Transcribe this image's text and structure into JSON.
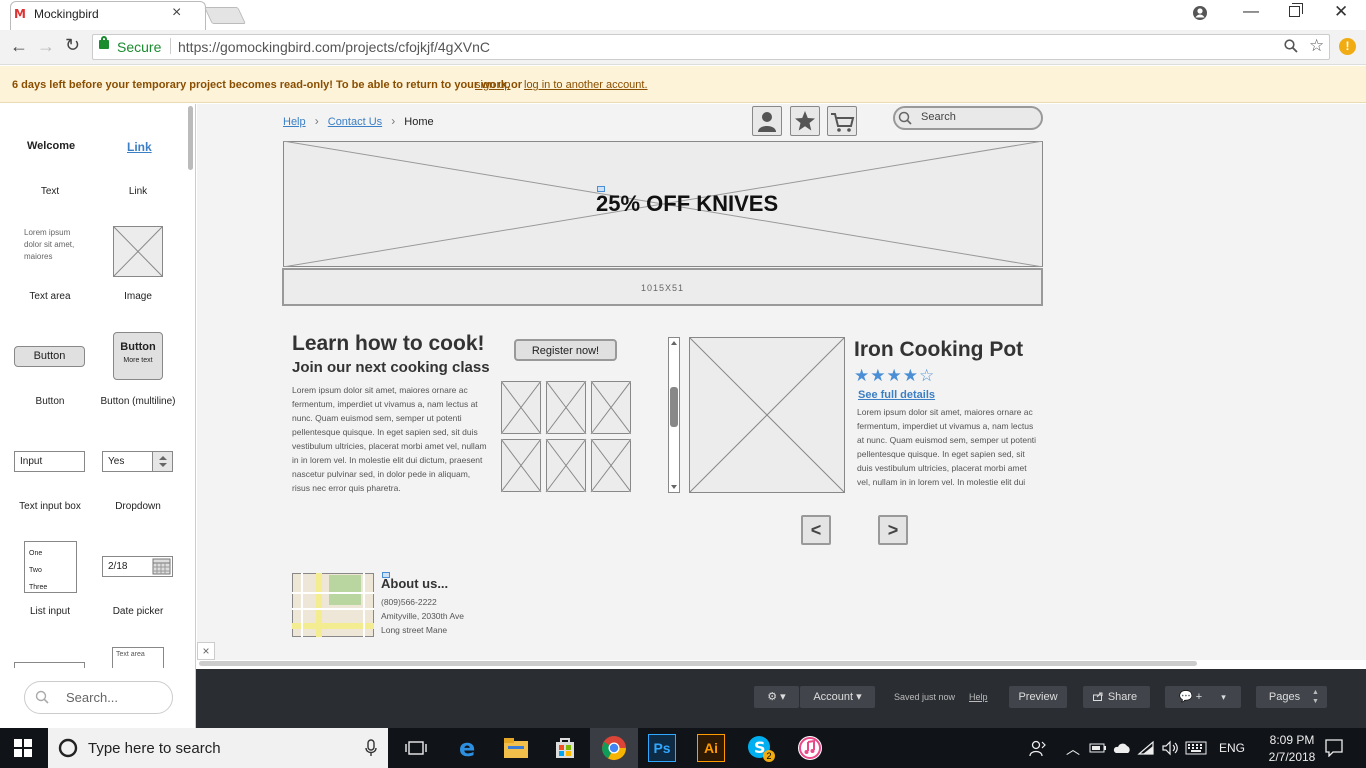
{
  "browser": {
    "tab_title": "Mockingbird",
    "tab_favicon": "M",
    "tab_close": "×",
    "secure_label": "Secure",
    "url": "https://gomockingbird.com/projects/cfojkjf/4gXVnC",
    "ext_badge": "!"
  },
  "banner": {
    "message": "6 days left before your temporary project becomes read-only! To be able to return to your work,",
    "signup": "sign up",
    "or": "or",
    "login": "log in to another account."
  },
  "palette": {
    "items": [
      {
        "preview": "Welcome",
        "label": "Text"
      },
      {
        "preview": "Link",
        "label": "Link"
      },
      {
        "preview": "Lorem ipsum dolor sit amet, maiores",
        "label": "Text area"
      },
      {
        "preview": "",
        "label": "Image"
      },
      {
        "preview": "Button",
        "label": "Button"
      },
      {
        "preview": "Button",
        "preview_sub": "More text",
        "label": "Button (multiline)"
      },
      {
        "preview": "Input",
        "label": "Text input box"
      },
      {
        "preview": "Yes",
        "label": "Dropdown"
      },
      {
        "preview_lines": [
          "One",
          "Two",
          "Three"
        ],
        "label": "List input"
      },
      {
        "preview": "2/18",
        "label": "Date picker"
      }
    ],
    "bottom_preview": "Text area",
    "search_placeholder": "Search..."
  },
  "canvas": {
    "breadcrumb": {
      "help": "Help",
      "contact": "Contact Us",
      "home": "Home"
    },
    "search_placeholder": "Search",
    "hero_text": "25% OFF KNIVES",
    "strip_label": "1015X51",
    "cook": {
      "heading": "Learn how to cook!",
      "subheading": "Join our next cooking class",
      "body": "Lorem ipsum dolor sit amet, maiores ornare ac fermentum, imperdiet ut vivamus a, nam lectus at nunc. Quam euismod sem, semper ut potenti pellentesque quisque. In eget sapien sed, sit duis vestibulum ultricies, placerat morbi amet vel, nullam in in lorem vel. In molestie elit dui dictum, praesent nascetur pulvinar sed, in dolor pede in aliquam, risus nec error quis pharetra.",
      "register_label": "Register now!"
    },
    "product": {
      "title": "Iron Cooking Pot",
      "rating": 4,
      "stars": "★★★★☆",
      "details_link": "See full details",
      "body": "Lorem ipsum dolor sit amet, maiores ornare ac fermentum, imperdiet ut vivamus a, nam lectus at nunc. Quam euismod sem, semper ut potenti pellentesque quisque. In eget sapien sed, sit duis vestibulum ultricies, placerat morbi amet vel, nullam in in lorem vel. In molestie elit dui"
    },
    "pager": {
      "prev": "<",
      "next": ">"
    },
    "about": {
      "heading": "About us...",
      "phone": "(809)566-2222",
      "address1": "Amityville, 2030th Ave",
      "address2": "Long street Mane"
    },
    "close_glyph": "×"
  },
  "toolbar": {
    "gear": "⚙ ▾",
    "account": "Account ▾",
    "saved": "Saved just now",
    "help": "Help",
    "preview": "Preview",
    "share": "Share",
    "comment": "+",
    "pages": "Pages"
  },
  "taskbar": {
    "search_placeholder": "Type here to search",
    "lang": "ENG",
    "time": "8:09 PM",
    "date": "2/7/2018",
    "ps_label": "Ps",
    "ai_label": "Ai",
    "skype_badge": "2"
  },
  "colors": {
    "banner_bg": "#fdf3d8",
    "banner_text": "#8a4e00",
    "link": "#3b7fc4",
    "secure": "#1a8b2f",
    "toolbar_bg": "#2a2d32",
    "star": "#4a8fd6"
  }
}
